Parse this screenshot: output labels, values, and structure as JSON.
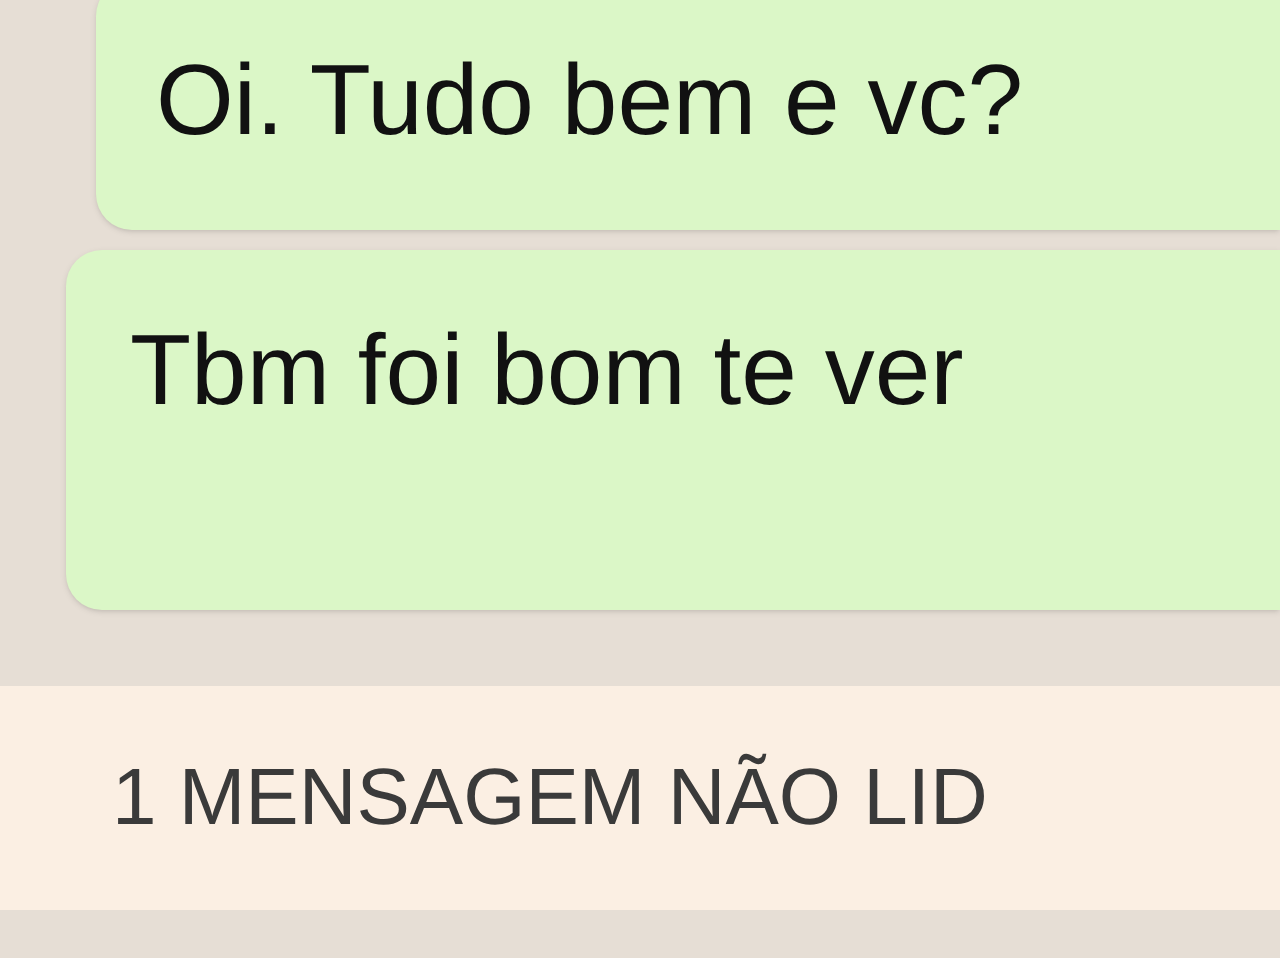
{
  "messages": [
    {
      "text": "Oi. Tudo bem e vc?",
      "kind": "outgoing"
    },
    {
      "text": "Tbm foi bom te ver",
      "kind": "outgoing"
    }
  ],
  "unread_banner": {
    "text": "1 MENSAGEM NÃO LID"
  }
}
